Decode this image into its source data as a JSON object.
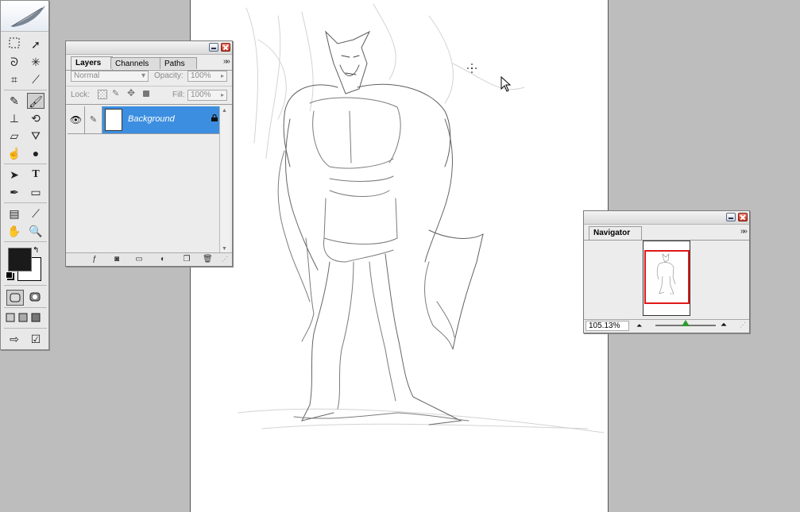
{
  "toolbox": {
    "tools": [
      "rectangular-marquee",
      "move",
      "lasso",
      "magic-wand",
      "crop",
      "slice",
      "healing-brush",
      "brush",
      "clone-stamp",
      "history-brush",
      "eraser",
      "paint-bucket",
      "smudge",
      "dodge",
      "path-selection",
      "type",
      "pen",
      "rectangle",
      "notes",
      "eyedropper",
      "hand",
      "zoom"
    ],
    "selected_tool": "brush",
    "type_tool_label": "T",
    "foreground_color": "#1a1a1a",
    "background_color": "#ffffff"
  },
  "layers_palette": {
    "tabs": [
      "Layers",
      "Channels",
      "Paths"
    ],
    "active_tab": "Layers",
    "blend_mode": "Normal",
    "opacity_label": "Opacity:",
    "opacity_value": "100%",
    "lock_label": "Lock:",
    "fill_label": "Fill:",
    "fill_value": "100%",
    "layers": [
      {
        "name": "Background",
        "visible": true,
        "locked": true,
        "selected": true
      }
    ]
  },
  "navigator_palette": {
    "tab": "Navigator",
    "zoom": "105.13%"
  },
  "colors": {
    "workspace": "#bdbdbd",
    "selection": "#3c8ee0",
    "nav_view_box": "#e01818"
  }
}
